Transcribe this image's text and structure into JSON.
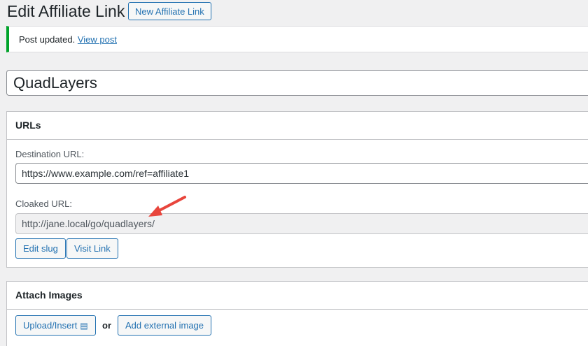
{
  "header": {
    "title": "Edit Affiliate Link",
    "new_button": "New Affiliate Link"
  },
  "notice": {
    "text": "Post updated.",
    "link": "View post"
  },
  "title_field": {
    "value": "QuadLayers"
  },
  "urls_box": {
    "heading": "URLs",
    "destination_label": "Destination URL:",
    "destination_value": "https://www.example.com/ref=affiliate1",
    "cloaked_label": "Cloaked URL:",
    "cloaked_value": "http://jane.local/go/quadlayers/",
    "edit_slug_button": "Edit slug",
    "visit_link_button": "Visit Link"
  },
  "images_box": {
    "heading": "Attach Images",
    "upload_button": "Upload/Insert",
    "or_text": "or",
    "external_button": "Add external image"
  },
  "colors": {
    "accent": "#2271b1",
    "success": "#00a32a",
    "annotation_arrow": "#e8453c"
  }
}
